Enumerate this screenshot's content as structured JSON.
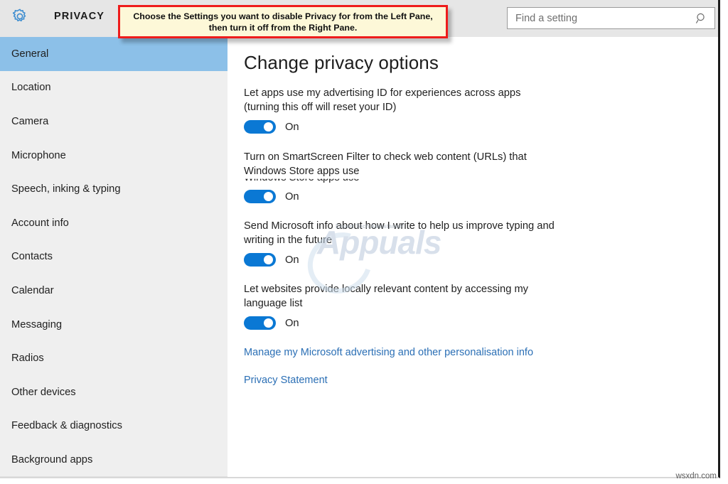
{
  "header": {
    "icon": "gear-icon",
    "title": "PRIVACY",
    "search": {
      "value": "",
      "placeholder": "Find a setting",
      "icon": "search-icon"
    }
  },
  "callout": {
    "text": "Choose the Settings you want to disable Privacy for from the Left Pane, then turn it off from the Right Pane.",
    "border_color": "#ee1c1c",
    "background_color": "#fdf8d8"
  },
  "sidebar": {
    "selected": "General",
    "highlight_color": "#8cc0e8",
    "background_color": "#efefef",
    "items": [
      {
        "label": "General"
      },
      {
        "label": "Location"
      },
      {
        "label": "Camera"
      },
      {
        "label": "Microphone"
      },
      {
        "label": "Speech, inking & typing"
      },
      {
        "label": "Account info"
      },
      {
        "label": "Contacts"
      },
      {
        "label": "Calendar"
      },
      {
        "label": "Messaging"
      },
      {
        "label": "Radios"
      },
      {
        "label": "Other devices"
      },
      {
        "label": "Feedback & diagnostics"
      },
      {
        "label": "Background apps"
      }
    ]
  },
  "main": {
    "title": "Change privacy options",
    "toggle_on_color": "#0a78d4",
    "settings": [
      {
        "label": "Let apps use my advertising ID for experiences across apps (turning this off will reset your ID)",
        "state": "On"
      },
      {
        "label": "Turn on SmartScreen Filter to check web content (URLs) that Windows Store apps use",
        "ghost_text": "Windows Store apps use",
        "state": "On"
      },
      {
        "label": "Send Microsoft info about how I write to help us improve typing and writing in the future",
        "state": "On"
      },
      {
        "label": "Let websites provide locally relevant content by accessing my language list",
        "state": "On"
      }
    ],
    "links": [
      {
        "label": "Manage my Microsoft advertising and other personalisation info"
      },
      {
        "label": "Privacy Statement"
      }
    ],
    "link_color": "#2b6fb5"
  },
  "watermarks": {
    "brand_name": "Appuals",
    "brand_tagline": "Expert Tech Assistance!",
    "site": "wsxdn.com"
  }
}
